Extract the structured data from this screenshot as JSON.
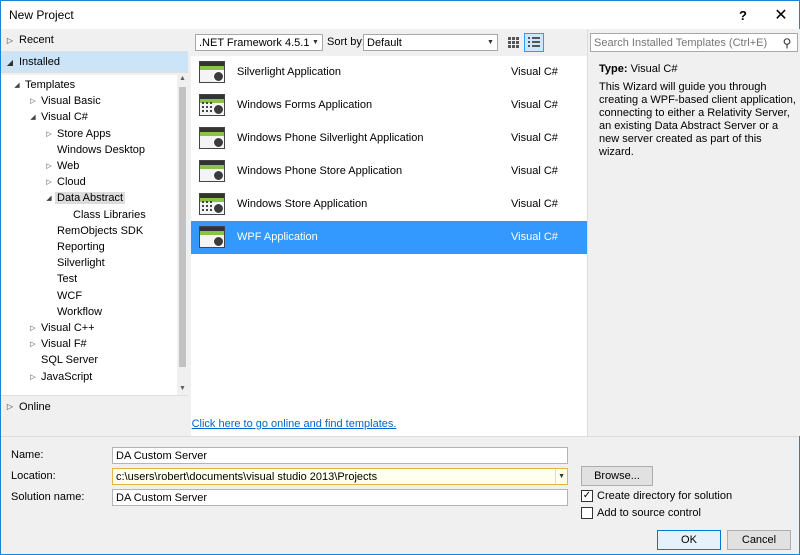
{
  "window": {
    "title": "New Project",
    "help_label": "?",
    "close_label": "✕"
  },
  "left": {
    "recent": "Recent",
    "installed": "Installed",
    "online": "Online",
    "tree": [
      {
        "label": "Templates",
        "indent": 0,
        "tri": "◢",
        "selected": false
      },
      {
        "label": "Visual Basic",
        "indent": 1,
        "tri": "▷",
        "selected": false
      },
      {
        "label": "Visual C#",
        "indent": 1,
        "tri": "◢",
        "selected": false
      },
      {
        "label": "Store Apps",
        "indent": 2,
        "tri": "▷",
        "selected": false
      },
      {
        "label": "Windows Desktop",
        "indent": 2,
        "tri": "",
        "selected": false
      },
      {
        "label": "Web",
        "indent": 2,
        "tri": "▷",
        "selected": false
      },
      {
        "label": "Cloud",
        "indent": 2,
        "tri": "▷",
        "selected": false
      },
      {
        "label": "Data Abstract",
        "indent": 2,
        "tri": "◢",
        "selected": true
      },
      {
        "label": "Class Libraries",
        "indent": 3,
        "tri": "",
        "selected": false
      },
      {
        "label": "RemObjects SDK",
        "indent": 2,
        "tri": "",
        "selected": false
      },
      {
        "label": "Reporting",
        "indent": 2,
        "tri": "",
        "selected": false
      },
      {
        "label": "Silverlight",
        "indent": 2,
        "tri": "",
        "selected": false
      },
      {
        "label": "Test",
        "indent": 2,
        "tri": "",
        "selected": false
      },
      {
        "label": "WCF",
        "indent": 2,
        "tri": "",
        "selected": false
      },
      {
        "label": "Workflow",
        "indent": 2,
        "tri": "",
        "selected": false
      },
      {
        "label": "Visual C++",
        "indent": 1,
        "tri": "▷",
        "selected": false
      },
      {
        "label": "Visual F#",
        "indent": 1,
        "tri": "▷",
        "selected": false
      },
      {
        "label": "SQL Server",
        "indent": 1,
        "tri": "",
        "selected": false
      },
      {
        "label": "JavaScript",
        "indent": 1,
        "tri": "▷",
        "selected": false
      }
    ]
  },
  "toolbar": {
    "framework": ".NET Framework 4.5.1",
    "sort_label": "Sort by:",
    "sort_value": "Default"
  },
  "templates": [
    {
      "name": "Silverlight Application",
      "lang": "Visual C#",
      "icon": "silverlight-app-icon",
      "selected": false
    },
    {
      "name": "Windows Forms Application",
      "lang": "Visual C#",
      "icon": "winforms-app-icon",
      "selected": false
    },
    {
      "name": "Windows Phone Silverlight Application",
      "lang": "Visual C#",
      "icon": "wp-silverlight-app-icon",
      "selected": false
    },
    {
      "name": "Windows Phone Store Application",
      "lang": "Visual C#",
      "icon": "wp-store-app-icon",
      "selected": false
    },
    {
      "name": "Windows Store Application",
      "lang": "Visual C#",
      "icon": "windows-store-app-icon",
      "selected": false
    },
    {
      "name": "WPF Application",
      "lang": "Visual C#",
      "icon": "wpf-app-icon",
      "selected": true
    }
  ],
  "online_link": "Click here to go online and find templates.",
  "right": {
    "search_placeholder": "Search Installed Templates (Ctrl+E)",
    "type_label": "Type:",
    "type_value": "Visual C#",
    "description": "This Wizard will guide you through creating a WPF-based client application, connecting to either a Relativity Server, an existing Data Abstract Server or a new server created as part of this wizard."
  },
  "form": {
    "name_label": "Name:",
    "name_value": "DA Custom Server",
    "location_label": "Location:",
    "location_value": "c:\\users\\robert\\documents\\visual studio 2013\\Projects",
    "solution_label": "Solution name:",
    "solution_value": "DA Custom Server",
    "browse_label": "Browse...",
    "create_dir_label": "Create directory for solution",
    "create_dir_checked": true,
    "source_control_label": "Add to source control",
    "source_control_checked": false,
    "ok_label": "OK",
    "cancel_label": "Cancel"
  },
  "colors": {
    "selection": "#3399ff",
    "tree_selected": "#cce4f7",
    "link": "#0066cc"
  }
}
